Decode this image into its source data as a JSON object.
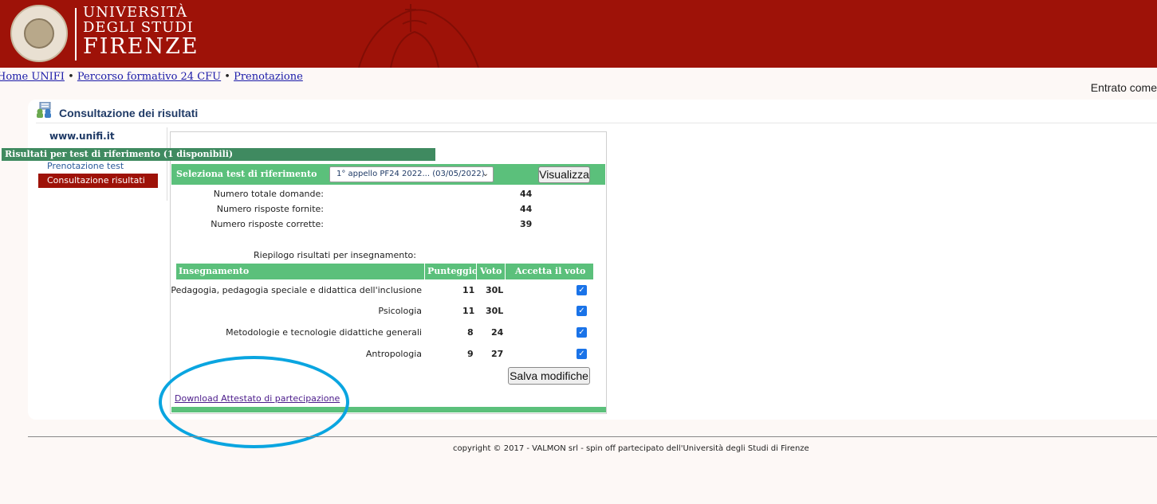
{
  "header": {
    "logo_line1": "UNIVERSITÀ",
    "logo_line2": "DEGLI STUDI",
    "logo_line3": "FIRENZE",
    "seal_lettering": "FLORENTINA STUDIORUM UNIVERSITAS"
  },
  "breadcrumb": {
    "home": "Home UNIFI",
    "sep": " • ",
    "percorso": "Percorso formativo 24 CFU",
    "prenotazione": "Prenotazione"
  },
  "user_label": "Entrato come",
  "page_title": "Consultazione dei risultati",
  "sidebar": {
    "site": "www.unifi.it",
    "items": [
      {
        "label": "Prenotazione test"
      },
      {
        "label": "Consultazione risultati"
      }
    ]
  },
  "panel": {
    "header": "Risultati per test di riferimento (1 disponibili)",
    "select_label": "Seleziona test di riferimento",
    "select_value": "1° appello PF24 2022... (03/05/2022)",
    "visualizza": "Visualizza",
    "stats": [
      {
        "label": "Numero totale domande:",
        "value": "44"
      },
      {
        "label": "Numero risposte fornite:",
        "value": "44"
      },
      {
        "label": "Numero risposte corrette:",
        "value": "39"
      }
    ],
    "riepilogo": "Riepilogo risultati per insegnamento:",
    "table": {
      "headers": [
        "Insegnamento",
        "Punteggio",
        "Voto",
        "Accetta il voto"
      ],
      "rows": [
        {
          "name": "Pedagogia, pedagogia speciale e didattica dell'inclusione",
          "punteggio": "11",
          "voto": "30L",
          "accetta": true
        },
        {
          "name": "Psicologia",
          "punteggio": "11",
          "voto": "30L",
          "accetta": true
        },
        {
          "name": "Metodologie e tecnologie didattiche generali",
          "punteggio": "8",
          "voto": "24",
          "accetta": true
        },
        {
          "name": "Antropologia",
          "punteggio": "9",
          "voto": "27",
          "accetta": true
        }
      ]
    },
    "save": "Salva modifiche",
    "download": "Download Attestato di partecipazione"
  },
  "footer": {
    "copyright": "copyright © 2017 - VALMON srl - spin off partecipato dell'Università degli Studi di Firenze"
  },
  "colors": {
    "header_red": "#9e1208",
    "panel_dark_green": "#3f8a60",
    "panel_green": "#5bc07b",
    "highlight_blue": "#0aa5e0",
    "checkbox_blue": "#1a73e8"
  },
  "icons": [
    "university-seal-icon",
    "results-icon",
    "chevron-down-icon",
    "checkbox-checked-icon"
  ]
}
